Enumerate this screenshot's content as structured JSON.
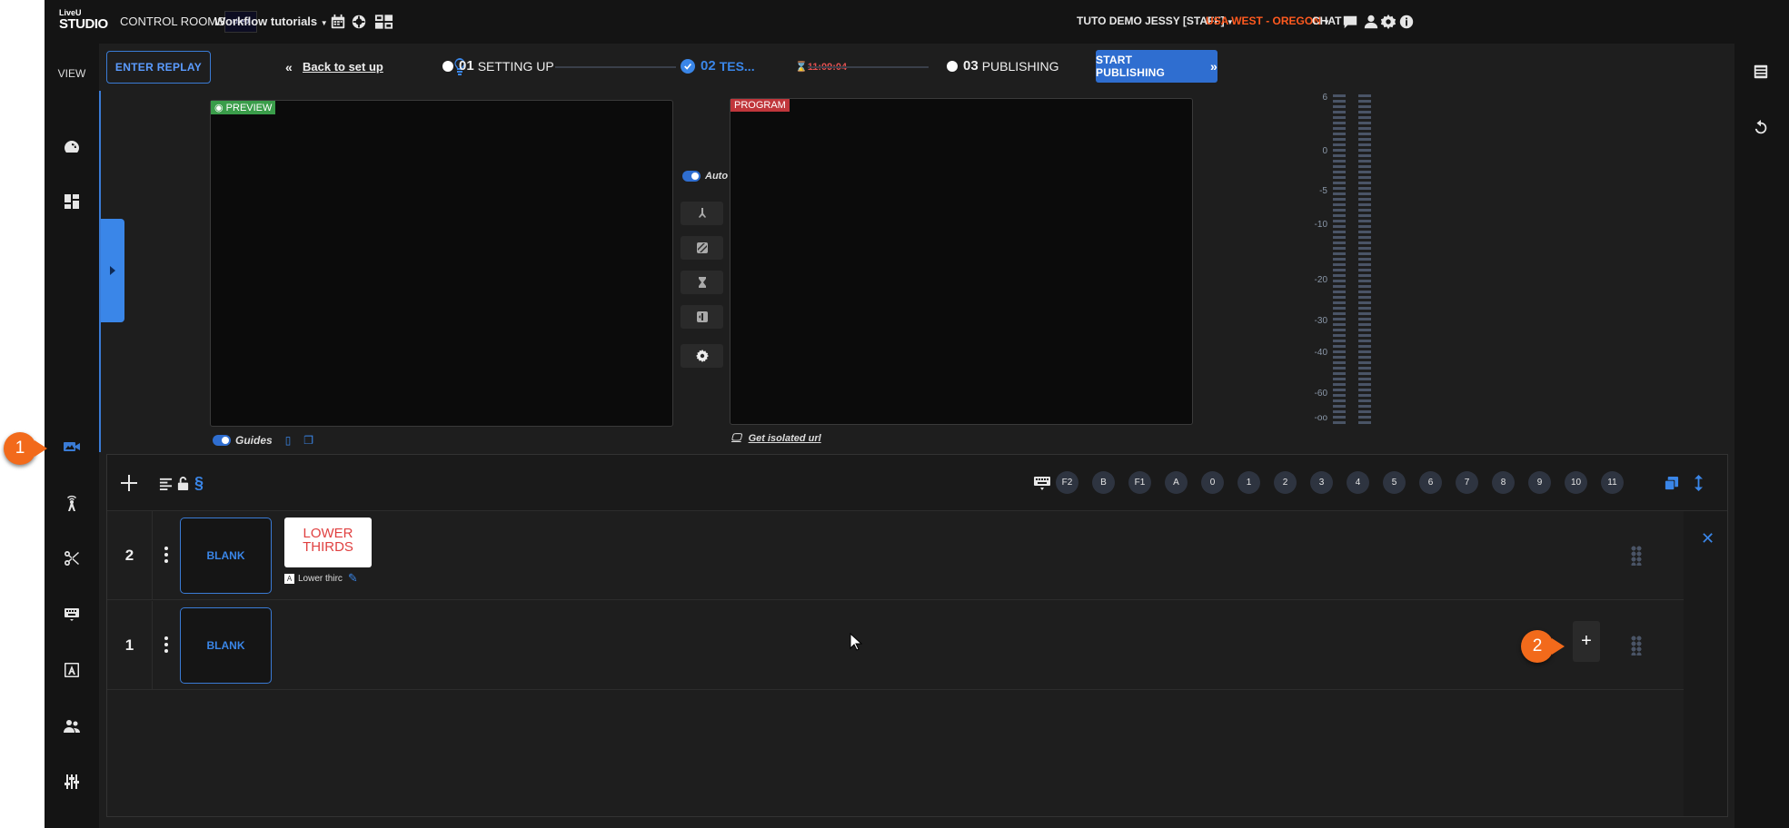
{
  "topbar": {
    "logo_top": "LiveU",
    "logo_bottom": "STUDIO",
    "control_rooms": "CONTROL ROOMS",
    "workspace_thumb": "LiveU",
    "workspace": "Workflow tutorials",
    "user": "TUTO DEMO JESSY [STAFF]",
    "region": "USA WEST - OREGON",
    "chat": "CHAT"
  },
  "leftnav": {
    "view": "VIEW"
  },
  "header": {
    "enter_replay": "ENTER REPLAY",
    "back": "Back to set up",
    "steps": [
      {
        "num": "01",
        "label": "SETTING UP"
      },
      {
        "num": "02",
        "label": "TES..."
      },
      {
        "num": "03",
        "label": "PUBLISHING"
      }
    ],
    "timer": "11:09:04",
    "start_publishing": "START PUBLISHING"
  },
  "preview": {
    "tag": "PREVIEW",
    "guides": "Guides"
  },
  "program": {
    "tag": "PROGRAM",
    "isolated": "Get isolated url"
  },
  "transitions": {
    "auto": "Auto"
  },
  "meter": {
    "scale": [
      "6",
      "0",
      "-5",
      "-10",
      "-20",
      "-30",
      "-40",
      "-60",
      "-oo"
    ]
  },
  "rundown": {
    "keys": [
      "F2",
      "B",
      "F1",
      "A",
      "0",
      "1",
      "2",
      "3",
      "4",
      "5",
      "6",
      "7",
      "8",
      "9",
      "10",
      "11"
    ],
    "rows": [
      {
        "num": "2",
        "blank": "BLANK",
        "card": "LOWER THIRDS",
        "card_label": "Lower thirc"
      },
      {
        "num": "1",
        "blank": "BLANK"
      }
    ]
  },
  "callouts": [
    "1",
    "2"
  ],
  "colors": {
    "accent": "#3a86e8",
    "brand_orange": "#f26a1b",
    "region": "#ff5a1f",
    "preview": "#3a9d4a",
    "program": "#c0363b"
  }
}
